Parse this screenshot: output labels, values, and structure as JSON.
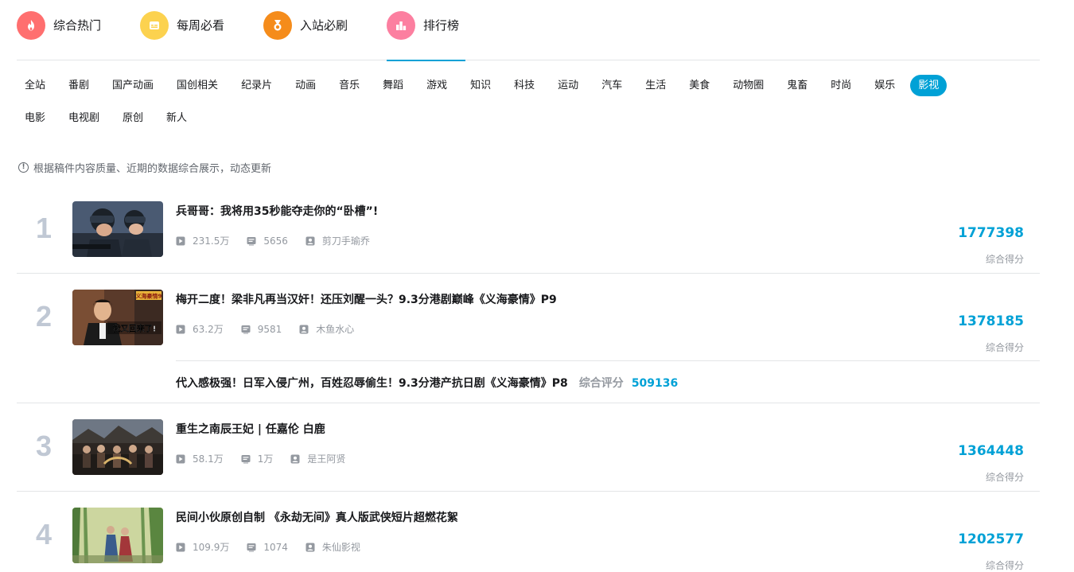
{
  "nav": {
    "items": [
      {
        "label": "综合热门",
        "icon": "flame-icon",
        "color": "#ff6f6f"
      },
      {
        "label": "每周必看",
        "icon": "calendar-icon",
        "color": "#fcd24f"
      },
      {
        "label": "入站必刷",
        "icon": "medal-icon",
        "color": "#f58c1b"
      },
      {
        "label": "排行榜",
        "icon": "bar-chart-icon",
        "color": "#fc7fa0"
      }
    ],
    "active_index": 3
  },
  "categories_row1": [
    "全站",
    "番剧",
    "国产动画",
    "国创相关",
    "纪录片",
    "动画",
    "音乐",
    "舞蹈",
    "游戏",
    "知识",
    "科技",
    "运动",
    "汽车",
    "生活",
    "美食",
    "动物圈",
    "鬼畜",
    "时尚",
    "娱乐",
    "影视"
  ],
  "categories_row2": [
    "电影",
    "电视剧",
    "原创",
    "新人"
  ],
  "active_category": "影视",
  "tip": "根据稿件内容质量、近期的数据综合展示，动态更新",
  "score_label": "综合得分",
  "ranks": [
    {
      "rank": "1",
      "title": "兵哥哥：我将用35秒能夺走你的“卧槽”!",
      "views": "231.5万",
      "danmaku": "5656",
      "uploader": "剪刀手瑜乔",
      "score": "1777398"
    },
    {
      "rank": "2",
      "title": "梅开二度！梁非凡再当汉奸！还压刘醒一头？9.3分港剧巅峰《义海豪情》P9",
      "views": "63.2万",
      "danmaku": "9581",
      "uploader": "木鱼水心",
      "score": "1378185",
      "sub": {
        "title": "代入感极强！日军入侵广州，百姓忍辱偷生！9.3分港产抗日剧《义海豪情》P8",
        "score_label": "综合评分",
        "score": "509136"
      }
    },
    {
      "rank": "3",
      "title": "重生之南辰王妃 | 任嘉伦 白鹿",
      "views": "58.1万",
      "danmaku": "1万",
      "uploader": "是王阿贤",
      "score": "1364448"
    },
    {
      "rank": "4",
      "title": "民间小伙原创自制 《永劫无间》真人版武侠短片超燃花絮",
      "views": "109.9万",
      "danmaku": "1074",
      "uploader": "朱仙影视",
      "score": "1202577"
    }
  ],
  "thumb_overlays": {
    "rank2_badge": "义海豪情9",
    "rank2_caption": "我又回来了!"
  },
  "colors": {
    "accent": "#00a1d6",
    "rank_number": "#c0c8d4",
    "meta": "#9499a0"
  }
}
